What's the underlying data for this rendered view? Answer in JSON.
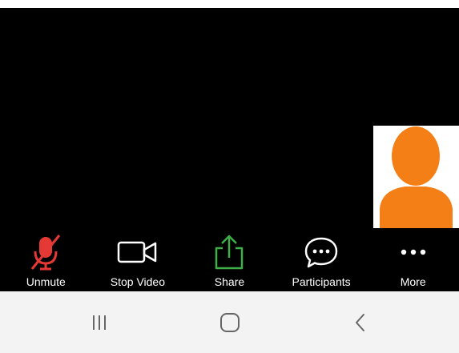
{
  "toolbar": {
    "items": [
      {
        "label": "Unmute",
        "icon": "muted-microphone-icon"
      },
      {
        "label": "Stop Video",
        "icon": "video-camera-icon"
      },
      {
        "label": "Share",
        "icon": "share-upload-icon"
      },
      {
        "label": "Participants",
        "icon": "chat-bubble-icon"
      },
      {
        "label": "More",
        "icon": "more-dots-icon"
      }
    ]
  },
  "self_view": {
    "avatar_color": "#f57f17"
  },
  "navbar": {
    "items": [
      "recent-apps-icon",
      "home-icon",
      "back-icon"
    ]
  },
  "colors": {
    "muted_red": "#e53935",
    "share_green": "#3fae49",
    "toolbar_bg": "#000000",
    "navbar_bg": "#f3f3f3"
  }
}
